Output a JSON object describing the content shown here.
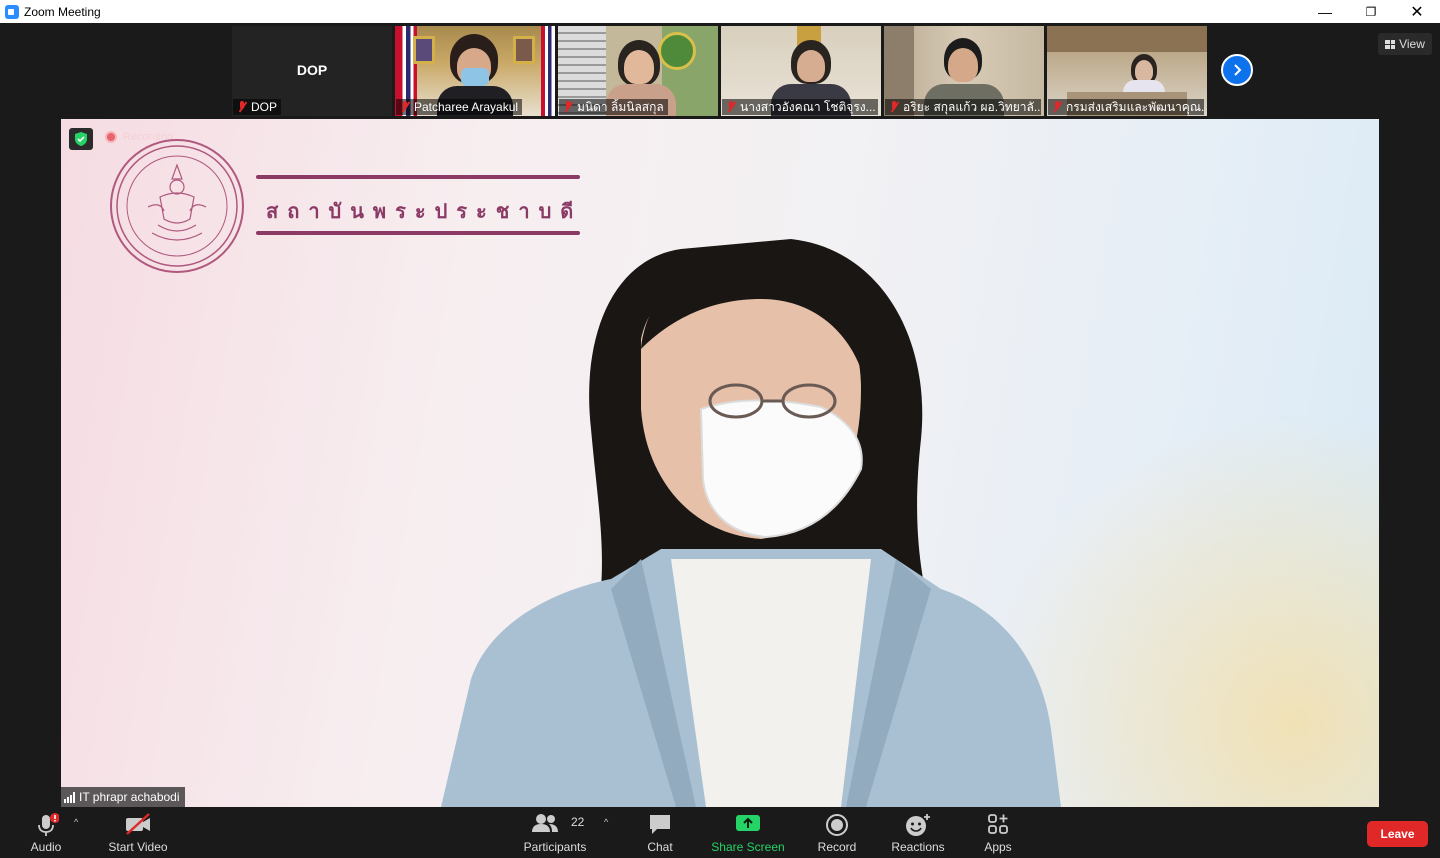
{
  "window": {
    "title": "Zoom Meeting",
    "minimize": "—",
    "restore": "❐",
    "close": "✕"
  },
  "strip": {
    "view_label": "View",
    "participants": [
      {
        "label": "DOP",
        "tile_text": "DOP",
        "muted": true
      },
      {
        "label": "Patcharee Arayakul",
        "muted": true
      },
      {
        "label": "มนิดา ลิ้มนิลสกุล",
        "muted": true
      },
      {
        "label": "นางสาวอังคณา โชติจุรง...",
        "muted": true
      },
      {
        "label": "อริยะ สกุลแก้ว ผอ.วิทยาลั...",
        "muted": true
      },
      {
        "label": "กรมส่งเสริมและพัฒนาคุณ...",
        "muted": true
      }
    ]
  },
  "main": {
    "recording_label": "Recording",
    "brand_text": "สถาบันพระประชาบดี",
    "speaker_name": "IT phrapr achabodi"
  },
  "toolbar": {
    "audio": "Audio",
    "start_video": "Start Video",
    "participants": "Participants",
    "participants_count": "22",
    "chat": "Chat",
    "share_screen": "Share Screen",
    "record": "Record",
    "reactions": "Reactions",
    "apps": "Apps",
    "leave": "Leave"
  },
  "colors": {
    "zoom_blue": "#0e72ed",
    "leave_red": "#e02828",
    "share_green": "#25d366",
    "brand_purple": "#8a3a64"
  }
}
